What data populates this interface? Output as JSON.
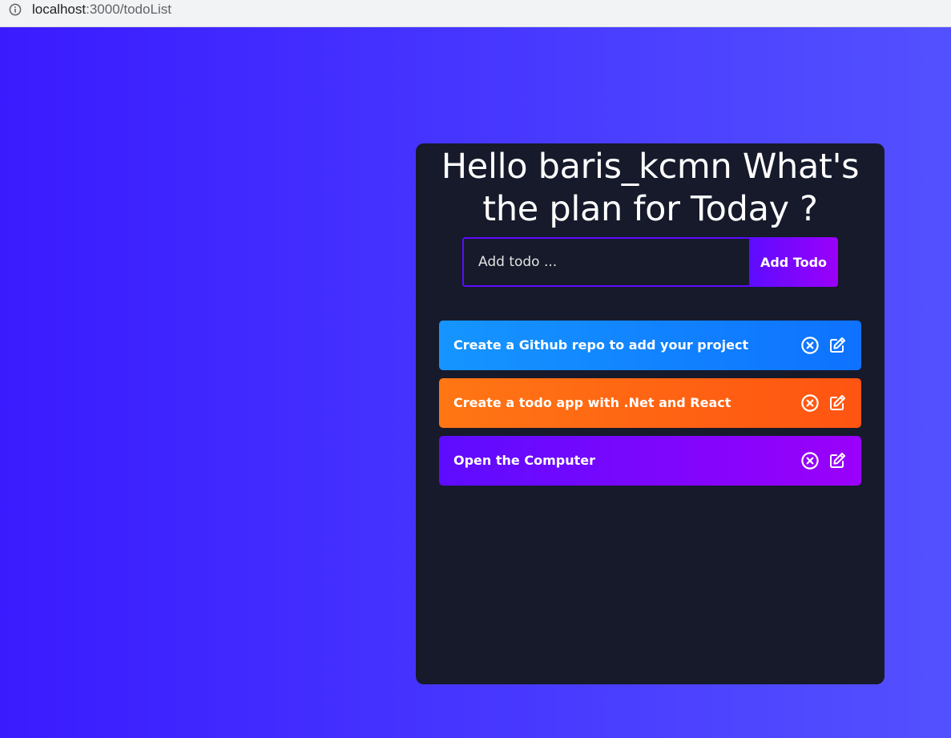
{
  "browser": {
    "url_host": "localhost",
    "url_path": ":3000/todoList"
  },
  "app": {
    "heading": "Hello baris_kcmn What's the plan for Today ?",
    "input_placeholder": "Add todo ...",
    "input_value": "",
    "add_button_label": "Add Todo",
    "todos": [
      {
        "text": "Create a Github repo to add your project"
      },
      {
        "text": "Create a todo app with .Net and React"
      },
      {
        "text": "Open the Computer"
      }
    ]
  },
  "icons": {
    "info": "info-icon",
    "delete": "close-circle-icon",
    "edit": "edit-icon"
  },
  "colors": {
    "page_gradient_start": "#3a1bff",
    "page_gradient_end": "#5351ff",
    "panel": "#161a2b",
    "accent": "#5d0cff",
    "todo_1": "#1595ff",
    "todo_2": "#ff7614",
    "todo_3": "#5d0cff"
  }
}
